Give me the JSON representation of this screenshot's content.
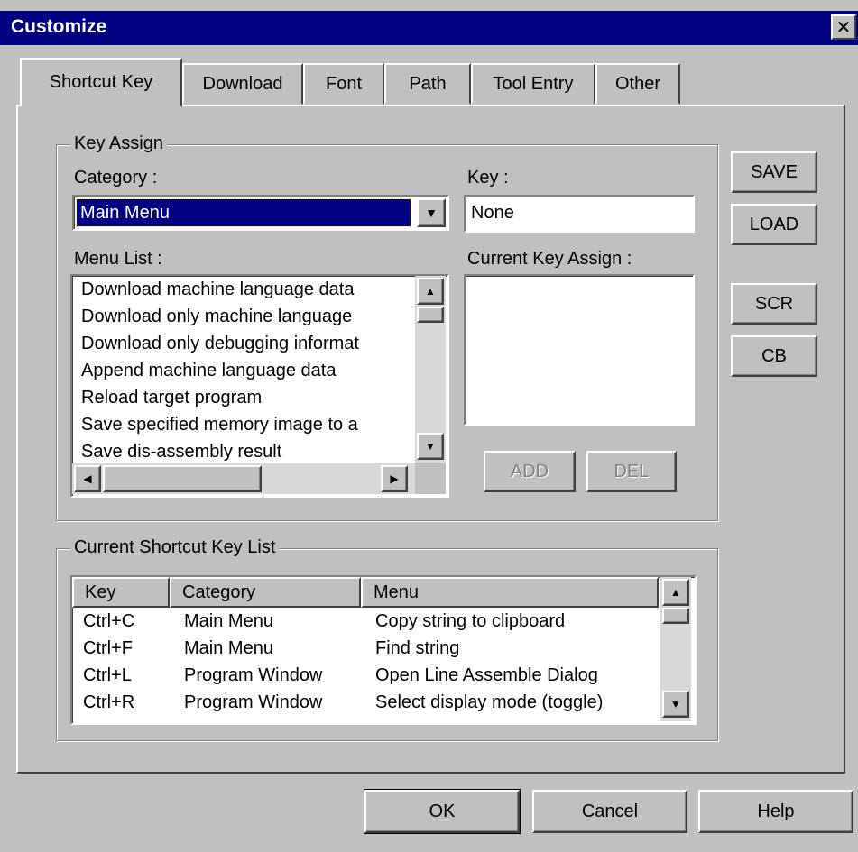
{
  "window": {
    "title": "Customize",
    "close_glyph": "✕"
  },
  "tabs": [
    {
      "label": "Shortcut Key",
      "active": true
    },
    {
      "label": "Download",
      "active": false
    },
    {
      "label": "Font",
      "active": false
    },
    {
      "label": "Path",
      "active": false
    },
    {
      "label": "Tool Entry",
      "active": false
    },
    {
      "label": "Other",
      "active": false
    }
  ],
  "key_assign": {
    "group_label": "Key Assign",
    "category_label": "Category :",
    "category_value": "Main Menu",
    "key_label": "Key :",
    "key_value": "None",
    "menu_list_label": "Menu List :",
    "menu_list": [
      "Download machine language data",
      "Download only machine language",
      "Download only debugging informat",
      "Append machine language data",
      "Reload target program",
      "Save specified memory image to a",
      "Save dis-assembly result"
    ],
    "current_assign_label": "Current Key Assign :",
    "add_label": "ADD",
    "del_label": "DEL"
  },
  "side_buttons": {
    "save": "SAVE",
    "load": "LOAD",
    "scr": "SCR",
    "cb": "CB"
  },
  "shortcut_list": {
    "group_label": "Current Shortcut Key List",
    "columns": [
      "Key",
      "Category",
      "Menu"
    ],
    "rows": [
      {
        "key": "Ctrl+C",
        "category": "Main Menu",
        "menu": "Copy string to clipboard"
      },
      {
        "key": "Ctrl+F",
        "category": "Main Menu",
        "menu": "Find string"
      },
      {
        "key": "Ctrl+L",
        "category": "Program Window",
        "menu": "Open Line Assemble Dialog"
      },
      {
        "key": "Ctrl+R",
        "category": "Program Window",
        "menu": "Select display mode (toggle)"
      }
    ]
  },
  "footer": {
    "ok": "OK",
    "cancel": "Cancel",
    "help": "Help"
  },
  "icons": {
    "up": "▲",
    "down": "▼",
    "left": "◀",
    "right": "▶",
    "combo": "▼"
  }
}
